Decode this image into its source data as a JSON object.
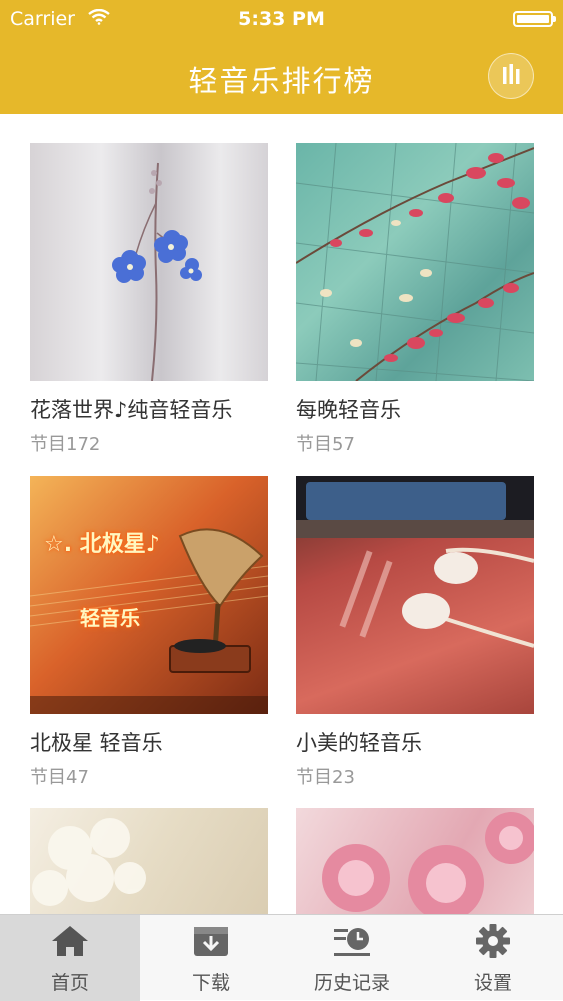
{
  "status_bar": {
    "carrier": "Carrier",
    "time": "5:33 PM"
  },
  "nav": {
    "title": "轻音乐排行榜",
    "player_icon": "equalizer-icon"
  },
  "colors": {
    "accent": "#e6b82a",
    "tab_active_bg": "#d9d9d9"
  },
  "albums": [
    {
      "name": "花落世界♪纯音轻音乐",
      "count": "节目172",
      "image_text": ""
    },
    {
      "name": "每晚轻音乐",
      "count": "节目57",
      "image_text": ""
    },
    {
      "name": "北极星 轻音乐",
      "count": "节目47",
      "image_text": "☆. 北极星♪",
      "image_text_2": "轻音乐"
    },
    {
      "name": "小美的轻音乐",
      "count": "节目23",
      "image_text": ""
    },
    {
      "name": "",
      "count": ""
    },
    {
      "name": "",
      "count": ""
    }
  ],
  "tabs": [
    {
      "label": "首页",
      "icon": "home-icon",
      "active": true
    },
    {
      "label": "下载",
      "icon": "download-icon",
      "active": false
    },
    {
      "label": "历史记录",
      "icon": "history-icon",
      "active": false
    },
    {
      "label": "设置",
      "icon": "gear-icon",
      "active": false
    }
  ]
}
